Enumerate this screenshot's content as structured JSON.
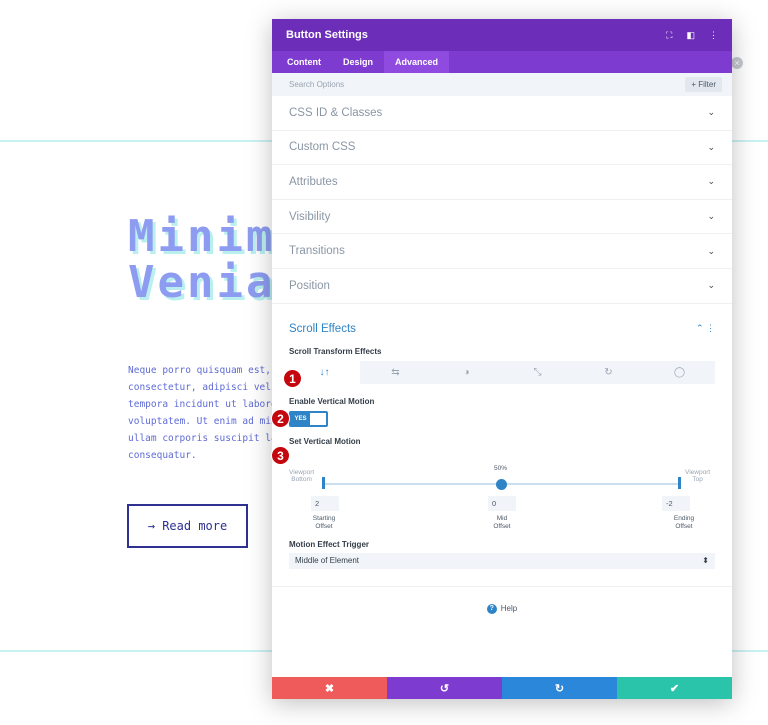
{
  "page": {
    "hero_title": "Minim\nVenia",
    "hero_body": "Neque porro quisquam est, qu\nconsectetur, adipisci velit,\ntempora incidunt ut labore e\nvoluptatem. Ut enim ad minim\nullam corporis suscipit labo\nconsequatur.",
    "read_more_label": "→ Read more",
    "close_glyph": "×"
  },
  "modal": {
    "title": "Button Settings",
    "header_icons": [
      "⛶",
      "◧",
      "⋮"
    ],
    "tabs": [
      {
        "label": "Content",
        "active": false
      },
      {
        "label": "Design",
        "active": false
      },
      {
        "label": "Advanced",
        "active": true
      }
    ],
    "search_placeholder": "Search Options",
    "filter_label": "+ Filter",
    "sections": [
      {
        "label": "CSS ID & Classes",
        "chevron": "⌄"
      },
      {
        "label": "Custom CSS",
        "chevron": "⌄"
      },
      {
        "label": "Attributes",
        "chevron": "⌄"
      },
      {
        "label": "Visibility",
        "chevron": "⌄"
      },
      {
        "label": "Transitions",
        "chevron": "⌄"
      },
      {
        "label": "Position",
        "chevron": "⌄"
      }
    ],
    "scroll_effects": {
      "title": "Scroll Effects",
      "controls": "⌃  ⋮",
      "transform_label": "Scroll Transform Effects",
      "effect_tabs": [
        {
          "icon": "vertical-motion-icon",
          "glyph": "↓↑",
          "active": true
        },
        {
          "icon": "horizontal-motion-icon",
          "glyph": "⇆",
          "active": false
        },
        {
          "icon": "fading-icon",
          "glyph": "◑",
          "active": false
        },
        {
          "icon": "scaling-icon",
          "glyph": "⤡",
          "active": false
        },
        {
          "icon": "rotating-icon",
          "glyph": "↻",
          "active": false
        },
        {
          "icon": "blur-icon",
          "glyph": "◯",
          "active": false
        }
      ],
      "enable_label": "Enable Vertical Motion",
      "toggle_value": "YES",
      "set_label": "Set Vertical Motion",
      "viewport_bottom": "Viewport\nBottom",
      "viewport_top": "Viewport\nTop",
      "mid_percent": "50%",
      "starting": {
        "value": "2",
        "label": "Starting\nOffset"
      },
      "mid": {
        "value": "0",
        "label": "Mid\nOffset"
      },
      "ending": {
        "value": "-2",
        "label": "Ending\nOffset"
      },
      "trigger_label": "Motion Effect Trigger",
      "trigger_value": "Middle of Element",
      "trigger_arrow": "⬍"
    },
    "help_label": "Help",
    "help_glyph": "?",
    "footer": [
      {
        "glyph": "✖",
        "color": "#ef5a5a",
        "name": "discard"
      },
      {
        "glyph": "↺",
        "color": "#7e3bd0",
        "name": "undo"
      },
      {
        "glyph": "↻",
        "color": "#2b87da",
        "name": "redo"
      },
      {
        "glyph": "✔",
        "color": "#29c4a9",
        "name": "save"
      }
    ]
  },
  "annotations": [
    "1",
    "2",
    "3"
  ],
  "colors": {
    "header_purple": "#6c2eb9",
    "accent_blue": "#2e84c7",
    "badge_red": "#c4070e"
  }
}
